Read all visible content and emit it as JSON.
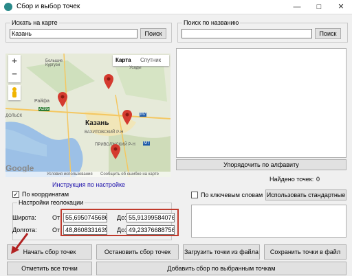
{
  "window": {
    "title": "Сбор и выбор точек"
  },
  "left_search": {
    "legend": "Искать на карте",
    "value": "Казань",
    "button": "Поиск"
  },
  "right_search": {
    "legend": "Поиск по названию",
    "value": "",
    "button": "Поиск"
  },
  "map": {
    "tabs": {
      "map": "Карта",
      "satellite": "Спутник"
    },
    "zoom_in": "+",
    "zoom_out": "−",
    "places": {
      "kurgusi": "Большие\nКургузи",
      "usady": "Усады",
      "rayfa": "Райфа",
      "dolsk": "ДОЛЬСК",
      "kazan": "Казань",
      "vakh": "ВАХИТОВСКИЙ Р-Н",
      "privolzh": "ПРИВОЛЖСКИЙ Р-Н",
      "road1": "A295",
      "road2": "M7",
      "road3": "M7"
    },
    "footer_terms": "Условия использования",
    "footer_report": "Сообщить об ошибке на карте",
    "logo": "Google"
  },
  "instruction_link": "Инструкция по настройке",
  "by_coords": {
    "label": "По координатам",
    "checked": true
  },
  "geo_settings": {
    "legend": "Настройки геолокации",
    "lat_label": "Широта:",
    "lon_label": "Долгота:",
    "from": "От:",
    "to": "До:",
    "lat_from": "55,6950745686(",
    "lat_to": "55,91399584076:",
    "lon_from": "48,8608331639(",
    "lon_to": "49,23376688756:"
  },
  "sort_button": "Упорядочить по алфавиту",
  "found_points": {
    "label": "Найдено точек:",
    "value": "0"
  },
  "keywords": {
    "label": "По ключевым словам",
    "checked": false,
    "button": "Использовать стандартные"
  },
  "buttons": {
    "start": "Начать сбор точек",
    "stop": "Остановить сбор точек",
    "load": "Загрузить точки из файла",
    "save": "Сохранить точки в файл",
    "mark_all": "Отметить все точки",
    "add_selected": "Добавить сбор по выбранным точкам"
  },
  "colors": {
    "pin": "#d43a2f",
    "highlight_box": "#c0392b",
    "link": "#1a0dab",
    "arrow": "#b22222"
  }
}
